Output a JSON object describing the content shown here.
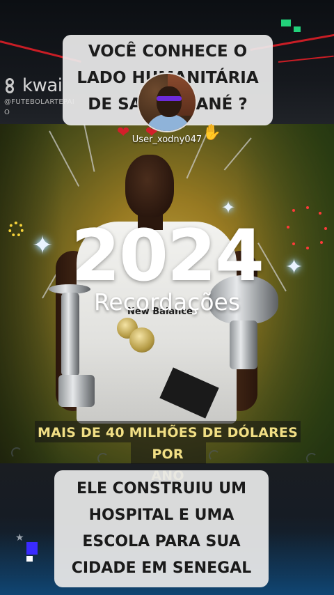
{
  "branding": {
    "app_name": "kwai",
    "handle_line1": "@FUTEBOLARTEPAI",
    "handle_line2": "O"
  },
  "header": {
    "title": "VOCÊ  CONHECE O LADO HUMANITÁRIA DE SADIO MANÉ ?"
  },
  "overlay": {
    "username": "User_xodny047",
    "reactions": [
      "heart-icon",
      "heart-icon",
      "heart-icon",
      "clap-icon"
    ]
  },
  "banner": {
    "year": "2024",
    "subtitle": "Recordações"
  },
  "photo": {
    "jersey_text": "New Balance"
  },
  "caption": {
    "line1": "MAIS DE 40 MILHÕES DE DÓLARES POR",
    "line2": "ANO"
  },
  "info_box": {
    "text": "ELE CONSTRUIU UM HOSPITAL E UMA ESCOLA PARA SUA CIDADE EM SENEGAL"
  },
  "colors": {
    "accent_red": "#c81d25",
    "caption_yellow": "#f1df85",
    "corner_green": "#22d17a",
    "corner_blue": "#3a2bff"
  }
}
